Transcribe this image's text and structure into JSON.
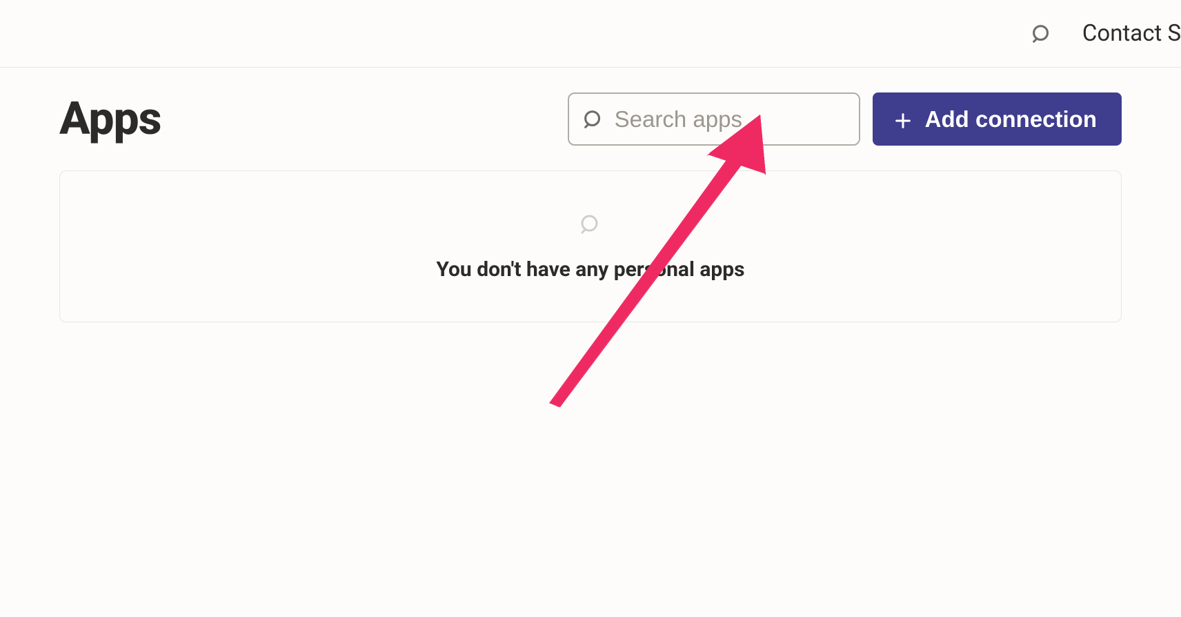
{
  "header": {
    "contact_label": "Contact Sa"
  },
  "page": {
    "title": "Apps"
  },
  "search": {
    "placeholder": "Search apps",
    "value": ""
  },
  "actions": {
    "add_connection_label": "Add connection"
  },
  "empty_state": {
    "message": "You don't have any personal apps"
  },
  "colors": {
    "accent": "#3f3d8e",
    "annotation": "#ef2a63"
  }
}
